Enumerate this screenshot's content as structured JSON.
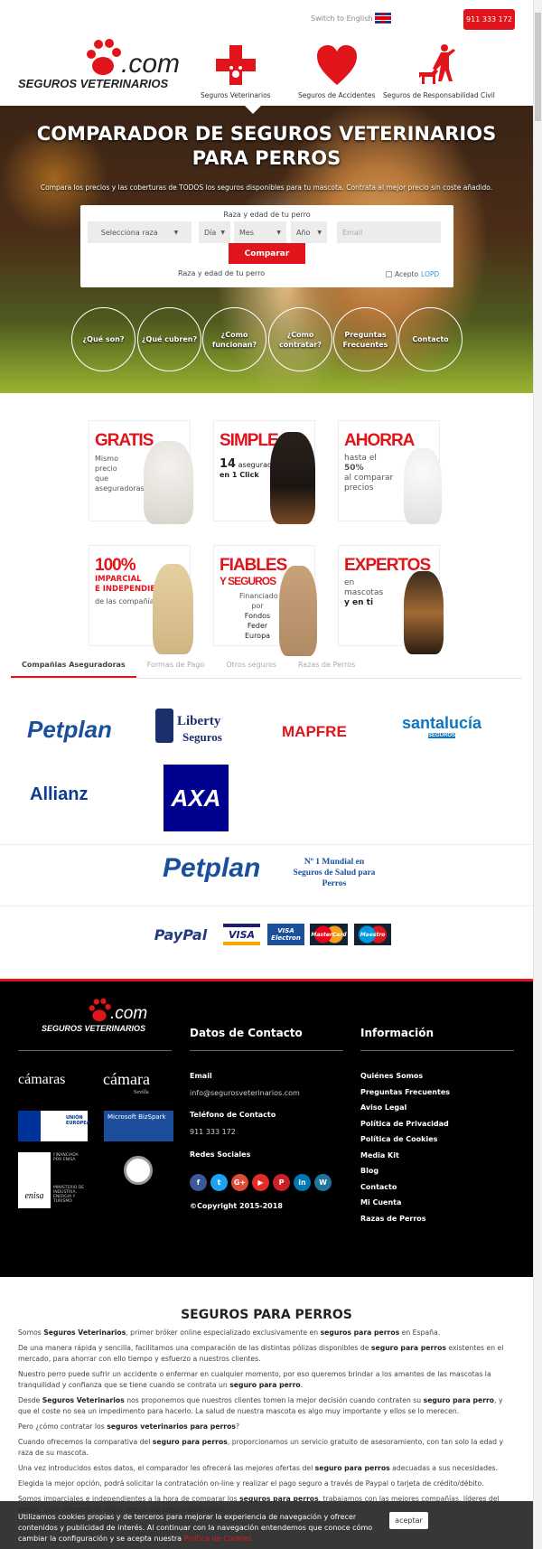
{
  "header": {
    "switch_language": "Switch to English",
    "phone": "911 333 172",
    "logo": {
      "com": ".com",
      "name": "SEGUROS VETERINARIOS"
    },
    "nav": [
      {
        "label": "Seguros Veterinarios"
      },
      {
        "label": "Seguros de Accidentes"
      },
      {
        "label": "Seguros de Responsabilidad Civil"
      }
    ]
  },
  "hero": {
    "title_line1": "COMPARADOR DE SEGUROS VETERINARIOS",
    "title_line2": "PARA PERROS",
    "subtitle": "Compara los precios y las coberturas de TODOS los seguros disponibles para tu mascota. Contrata al mejor precio sin coste añadido.",
    "form": {
      "label": "Raza y edad de tu perro",
      "breed": "Selecciona raza",
      "day": "Día",
      "month": "Mes",
      "year": "Año",
      "email_placeholder": "Email",
      "submit": "Comparar",
      "label_bottom": "Raza y edad de tu perro",
      "accept": "Acepto",
      "lopd": "LOPD"
    },
    "circles": [
      "¿Qué son?",
      "¿Qué cubren?",
      "¿Como funcionan?",
      "¿Como contratar?",
      "Preguntas Frecuentes",
      "Contacto"
    ]
  },
  "features": [
    {
      "title": "GRATIS",
      "text": "Mismo precio que aseguradoras"
    },
    {
      "title": "SIMPLE",
      "num": "14",
      "text": "aseguradoras",
      "text2": "en 1 Click"
    },
    {
      "title": "AHORRA",
      "text": "hasta el",
      "pct": "50%",
      "text2": "al comparar precios"
    },
    {
      "title": "100%",
      "sub1": "IMPARCIAL",
      "sub2": "E INDEPENDIENTE",
      "text": "de las compañías"
    },
    {
      "title": "FIABLES",
      "sub1": "Y SEGUROS",
      "text": "Financiado por",
      "text2": "Fondos Feder Europa"
    },
    {
      "title": "EXPERTOS",
      "text": "en mascotas",
      "text2": "y en ti"
    }
  ],
  "tabs": [
    "Compañias Aseguradoras",
    "Formas de Pago",
    "Otros seguros",
    "Razas de Perros"
  ],
  "insurers": {
    "petplan": "Petplan",
    "liberty": "Liberty",
    "liberty_sub": "Seguros",
    "mapfre": "MAPFRE",
    "santalucia": "santalucía",
    "santalucia_sub": "SEGUROS",
    "allianz": "Allianz",
    "axa": "AXA"
  },
  "banner": {
    "brand": "Petplan",
    "tagline": "Nº 1 Mundial en Seguros de Salud para Perros"
  },
  "payments": [
    "PayPal",
    "VISA",
    "VISA Electron",
    "MasterCard",
    "Maestro"
  ],
  "colors": {
    "brand_red": "#e1141b",
    "footer_bg": "#000000",
    "petplan_blue": "#1a4f9c"
  },
  "footer": {
    "partners": [
      "cámaras",
      "cámara",
      "Sevilla",
      "UNIÓN EUROPEA",
      "Microsoft BizSpark",
      "FINANCIADA POR ENISA",
      "enisa",
      "MINISTERIO DE INDUSTRIA, ENERGIA Y TURISMO"
    ],
    "contact_title": "Datos de Contacto",
    "email_label": "Email",
    "email": "info@segurosveterinarios.com",
    "phone_label": "Teléfono de Contacto",
    "phone": "911 333 172",
    "social_label": "Redes Sociales",
    "social": [
      "f",
      "t",
      "G+",
      "▶",
      "P",
      "in",
      "W"
    ],
    "copyright": "©Copyright 2015-2018",
    "info_title": "Información",
    "info_links": [
      "Quiénes Somos",
      "Preguntas Frecuentes",
      "Aviso Legal",
      "Política de Privacidad",
      "Política de Cookies",
      "Media Kit",
      "Blog",
      "Contacto",
      "Mi Cuenta",
      "Razas de Perros"
    ]
  },
  "article": {
    "title": "SEGUROS PARA PERROS"
  },
  "cookie": {
    "text": "Utilizamos cookies propias y de terceros para mejorar la experiencia de navegación y ofrecer contenidos y publicidad de interés. Al continuar con la navegación entendemos que conoce cómo cambiar la configuración y se acepta nuestra",
    "link": "Política de Cookies",
    "accept": "aceptar"
  }
}
